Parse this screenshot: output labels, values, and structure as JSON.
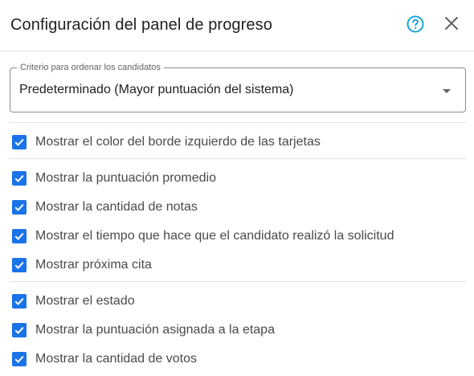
{
  "dialog": {
    "title": "Configuración del panel de progreso",
    "help_icon": "help-circle-icon",
    "close_icon": "close-icon"
  },
  "sort": {
    "label": "Criterio para ordenar los candidatos",
    "value": "Predeterminado (Mayor puntuación del sistema)"
  },
  "colors": {
    "accent": "#1a73e8",
    "help": "#1aa3d6"
  },
  "options": [
    {
      "label": "Mostrar el color del borde izquierdo de las tarjetas",
      "checked": true
    },
    {
      "label": "Mostrar la puntuación promedio",
      "checked": true
    },
    {
      "label": "Mostrar la cantidad de notas",
      "checked": true
    },
    {
      "label": "Mostrar el tiempo que hace que el candidato realizó la solicitud",
      "checked": true
    },
    {
      "label": "Mostrar próxima cita",
      "checked": true
    },
    {
      "label": "Mostrar el estado",
      "checked": true
    },
    {
      "label": "Mostrar la puntuación asignada a la etapa",
      "checked": true
    },
    {
      "label": "Mostrar la cantidad de votos",
      "checked": true
    }
  ]
}
